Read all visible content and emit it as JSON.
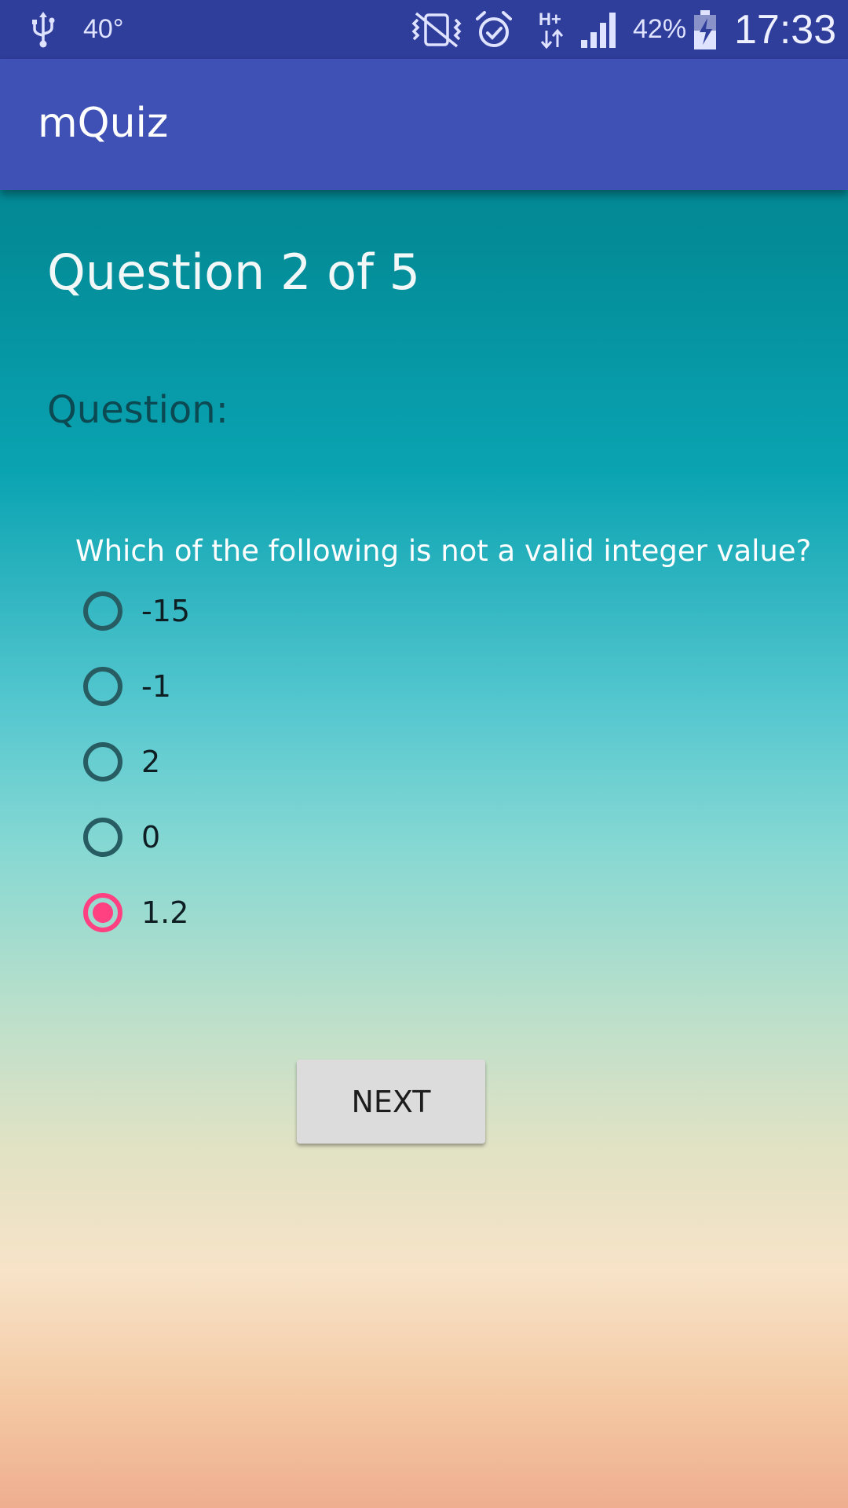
{
  "status_bar": {
    "temperature": "40°",
    "battery_percent": "42%",
    "network_type": "H+",
    "clock": "17:33",
    "icons": [
      "usb-icon",
      "vibrate-icon",
      "alarm-icon",
      "hplus-data-icon",
      "signal-icon",
      "battery-charging-icon"
    ]
  },
  "app_bar": {
    "title": "mQuiz"
  },
  "quiz": {
    "counter": "Question 2 of 5",
    "heading": "Question:",
    "question_text": "Which of the following is not a valid integer value?",
    "options": [
      {
        "label": "-15",
        "selected": false
      },
      {
        "label": "-1",
        "selected": false
      },
      {
        "label": "2",
        "selected": false
      },
      {
        "label": "0",
        "selected": false
      },
      {
        "label": "1.2",
        "selected": true
      }
    ],
    "next_label": "NEXT"
  },
  "colors": {
    "status_bar": "#2f3d9b",
    "app_bar": "#3f51b5",
    "accent": "#ff4081",
    "radio_unchecked": "#265c62"
  }
}
